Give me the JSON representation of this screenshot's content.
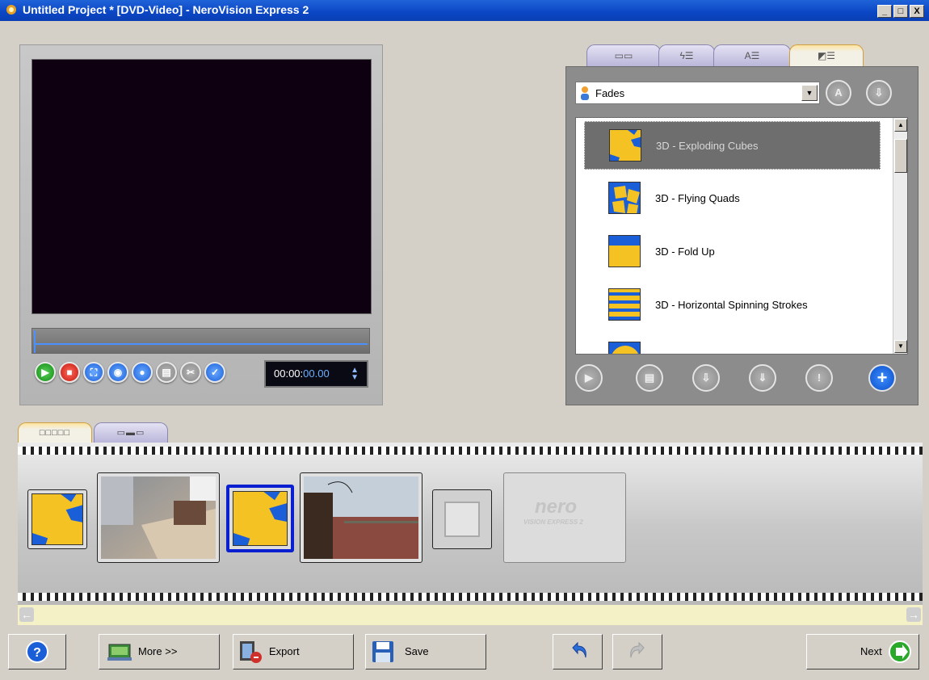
{
  "window": {
    "title": "Untitled Project * [DVD-Video] - NeroVision Express 2",
    "buttons": [
      "_",
      "□",
      "X"
    ]
  },
  "preview": {
    "timecode_prefix": "00:00:",
    "timecode_suffix": "00.00",
    "controls": [
      "play-icon",
      "stop-icon",
      "fullscreen-icon",
      "snapshot-icon",
      "download-icon",
      "filmstrip-icon",
      "scissors-icon",
      "check-icon"
    ]
  },
  "effects": {
    "category": "Fades",
    "items": [
      {
        "label": "3D - Exploding Cubes",
        "selected": true
      },
      {
        "label": "3D - Flying Quads",
        "selected": false
      },
      {
        "label": "3D - Fold Up",
        "selected": false
      },
      {
        "label": "3D - Horizontal Spinning Strokes",
        "selected": false
      }
    ]
  },
  "storyboard": {
    "logo_text": "nero",
    "logo_sub": "VISION EXPRESS 2"
  },
  "toolbar": {
    "more_label": "More >>",
    "export_label": "Export",
    "save_label": "Save",
    "next_label": "Next"
  },
  "colors": {
    "accent_blue": "#0c4fc8",
    "transition_yellow": "#f5c223",
    "selection_blue": "#0a1fd0"
  }
}
